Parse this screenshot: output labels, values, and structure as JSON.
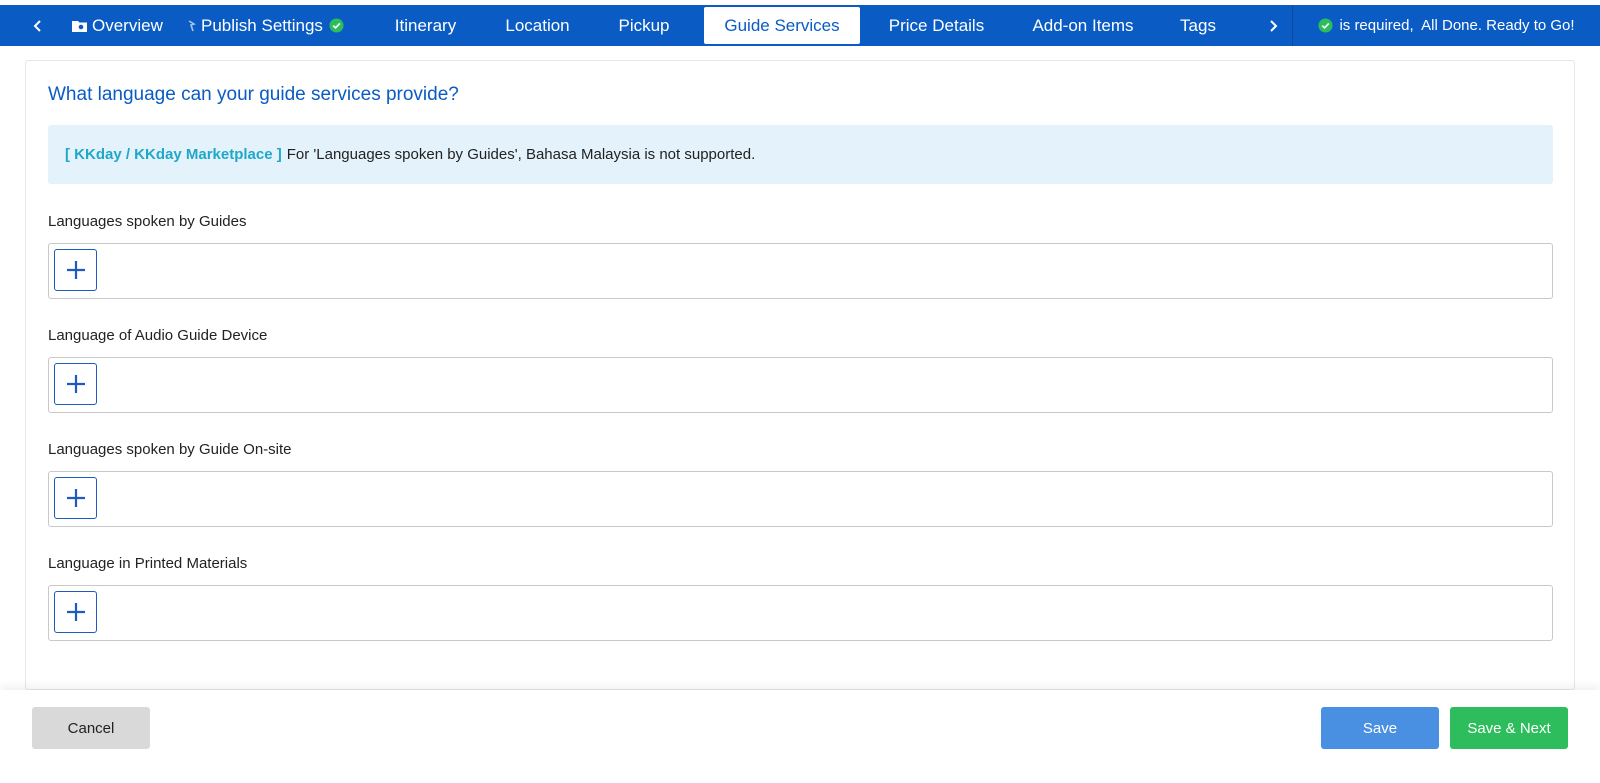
{
  "nav": {
    "tabs": [
      {
        "label": "Overview"
      },
      {
        "label": "Publish Settings"
      },
      {
        "label": "Itinerary"
      },
      {
        "label": "Location"
      },
      {
        "label": "Pickup"
      },
      {
        "label": "Guide Services"
      },
      {
        "label": "Price Details"
      },
      {
        "label": "Add-on Items"
      },
      {
        "label": "Tags"
      }
    ],
    "active_tab": "Guide Services",
    "status_text": "is required,  All Done. Ready to Go!"
  },
  "colors": {
    "brand_blue": "#0a5bc4",
    "success_green": "#2dbd5c",
    "notice_bg": "#e4f3fb",
    "notice_tag": "#21a7c9",
    "save_blue": "#4a90e2"
  },
  "icons": [
    "chevron-left-icon",
    "folder-icon",
    "publish-icon",
    "check-circle-icon",
    "chevron-right-icon",
    "plus-icon"
  ],
  "main": {
    "question": "What language can your guide services provide?",
    "notice": {
      "tag": "[ KKday / KKday Marketplace ]",
      "text": "For 'Languages spoken by Guides', Bahasa Malaysia is not supported."
    },
    "fields": [
      {
        "label": "Languages spoken by Guides"
      },
      {
        "label": "Language of Audio Guide Device"
      },
      {
        "label": "Languages spoken by Guide On-site"
      },
      {
        "label": "Language in Printed Materials"
      }
    ]
  },
  "footer": {
    "cancel_label": "Cancel",
    "save_label": "Save",
    "save_next_label": "Save & Next"
  }
}
